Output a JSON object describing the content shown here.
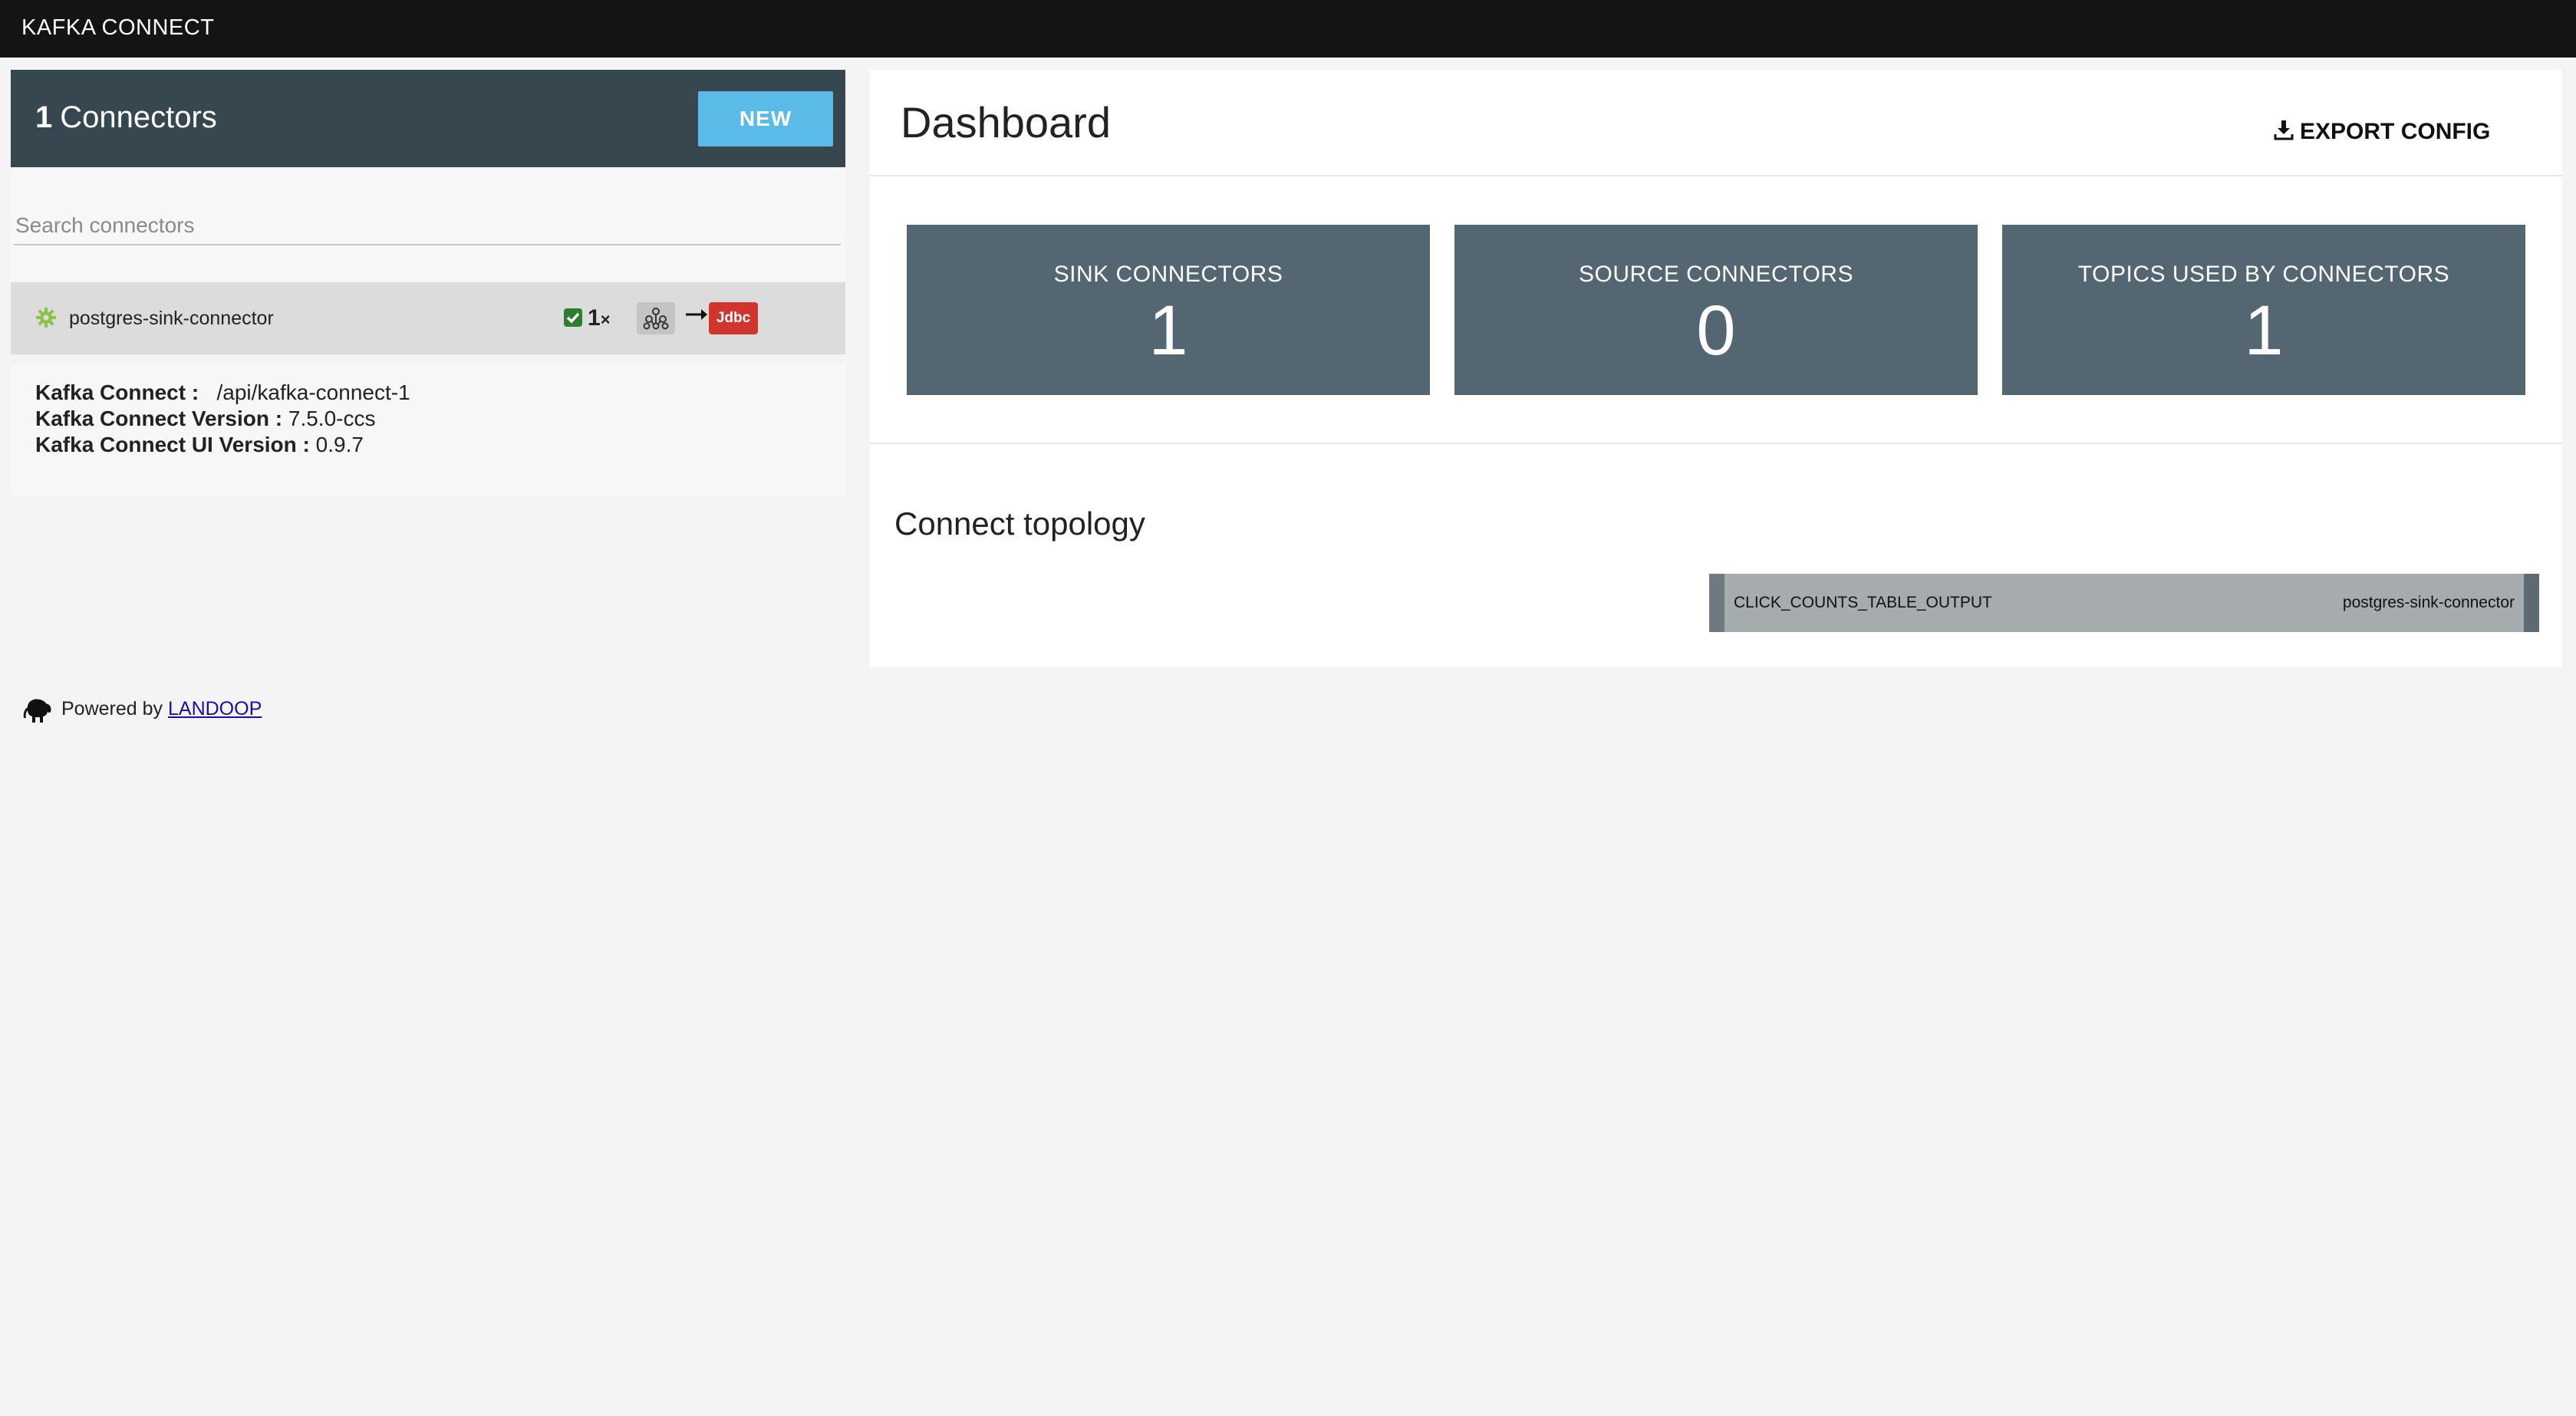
{
  "header": {
    "title": "KAFKA CONNECT"
  },
  "sidebar": {
    "connector_count": "1",
    "connectors_label": "Connectors",
    "new_button_label": "NEW",
    "search_placeholder": "Search connectors",
    "connectors": [
      {
        "name": "postgres-sink-connector",
        "tasks": "1",
        "tasks_suffix": "×",
        "plugin_badge": "Jdbc",
        "status_icon": "check-icon",
        "type_icon": "gear-icon",
        "source_icon": "kafka-icon"
      }
    ],
    "info": {
      "connect_label": "Kafka Connect :",
      "connect_value": "/api/kafka-connect-1",
      "version_label": "Kafka Connect Version :",
      "version_value": "7.5.0-ccs",
      "ui_version_label": "Kafka Connect UI Version :",
      "ui_version_value": "0.9.7"
    },
    "powered_by_label": "Powered by",
    "powered_by_link": "LANDOOP"
  },
  "main": {
    "title": "Dashboard",
    "export_label": "EXPORT CONFIG",
    "stats": [
      {
        "label": "SINK CONNECTORS",
        "value": "1"
      },
      {
        "label": "SOURCE CONNECTORS",
        "value": "0"
      },
      {
        "label": "TOPICS USED BY CONNECTORS",
        "value": "1"
      }
    ],
    "topology": {
      "title": "Connect topology",
      "topic": "CLICK_COUNTS_TABLE_OUTPUT",
      "connector": "postgres-sink-connector"
    }
  },
  "colors": {
    "topbar": "#141414",
    "sidebar_header": "#37474f",
    "new_button": "#5bbbe8",
    "stat_card": "#536672",
    "jdbc_badge": "#d0362d",
    "status_ok": "#2e7d32",
    "running_gear": "#8bc34a"
  }
}
